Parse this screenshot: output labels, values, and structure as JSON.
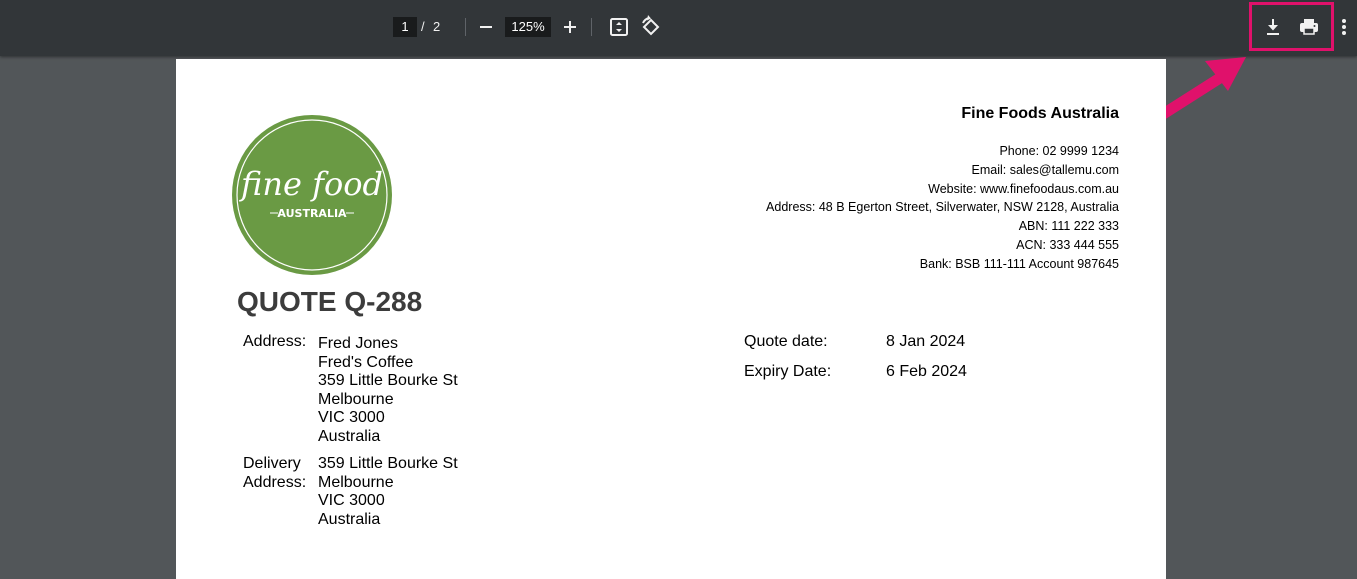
{
  "toolbar": {
    "current_page": "1",
    "page_separator": "/",
    "total_pages": "2",
    "zoom": "125%",
    "icons": [
      "minus-icon",
      "plus-icon",
      "fit-page-icon",
      "rotate-icon",
      "download-icon",
      "print-icon",
      "more-vert-icon"
    ]
  },
  "annotation": {
    "color": "#e0116b"
  },
  "logo": {
    "line1": "fine food",
    "line2": "AUSTRALIA",
    "color": "#6a9a44"
  },
  "document": {
    "title": "QUOTE Q-288",
    "company": {
      "name": "Fine Foods Australia",
      "phone": "Phone: 02 9999 1234",
      "email": "Email: sales@tallemu.com",
      "website": "Website: www.finefoodaus.com.au",
      "address": "Address: 48 B Egerton Street, Silverwater, NSW 2128, Australia",
      "abn": "ABN: 111 222 333",
      "acn": "ACN: 333 444 555",
      "bank": "Bank: BSB 111-111 Account 987645"
    },
    "address": {
      "label": "Address:",
      "lines": [
        "Fred Jones",
        "Fred's Coffee",
        "359 Little Bourke St",
        "Melbourne",
        "VIC 3000",
        "Australia"
      ]
    },
    "delivery": {
      "label_line1": "Delivery",
      "label_line2": "Address:",
      "lines": [
        "359 Little Bourke St",
        "Melbourne",
        "VIC 3000",
        "Australia"
      ]
    },
    "quote_date": {
      "label": "Quote date:",
      "value": "8 Jan 2024"
    },
    "expiry_date": {
      "label": "Expiry Date:",
      "value": "6 Feb 2024"
    }
  }
}
